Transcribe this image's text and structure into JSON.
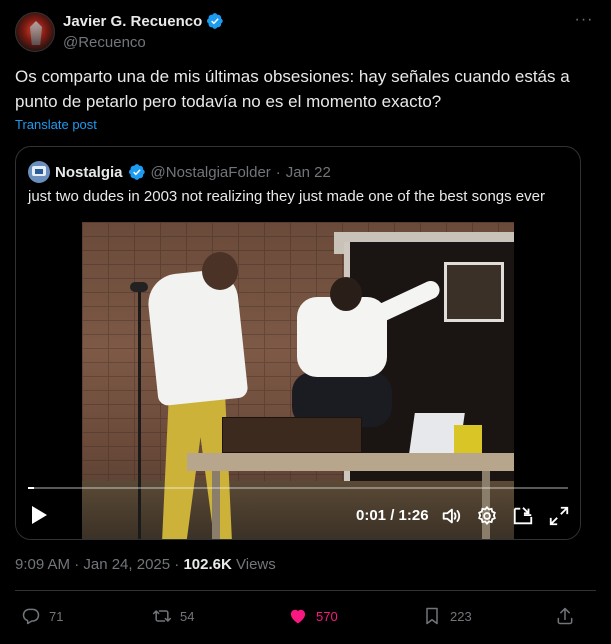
{
  "tweet": {
    "author": {
      "display_name": "Javier G. Recuenco",
      "handle": "@Recuenco",
      "verified": true
    },
    "text": "Os comparto una de mis últimas obsesiones: hay señales cuando estás a punto de petarlo pero todavía no es el momento exacto?",
    "translate_label": "Translate post",
    "timestamp": "9:09 AM · Jan 24, 2025",
    "separator": " · ",
    "views_count": "102.6K",
    "views_label": "Views"
  },
  "quoted": {
    "display_name": "Nostalgia",
    "handle": "@NostalgiaFolder",
    "dot": "·",
    "date": "Jan 22",
    "verified": true,
    "text": "just two dudes in 2003 not realizing they just made one of the best songs ever",
    "video": {
      "time": "0:01 / 1:26",
      "progress": 0.012
    }
  },
  "actions": {
    "replies": "71",
    "reposts": "54",
    "likes": "570",
    "bookmarks": "223"
  },
  "colors": {
    "accent": "#1d9bf0",
    "like": "#f91880",
    "muted": "#71767b",
    "text": "#e7e9ea",
    "border": "#2f3336"
  }
}
